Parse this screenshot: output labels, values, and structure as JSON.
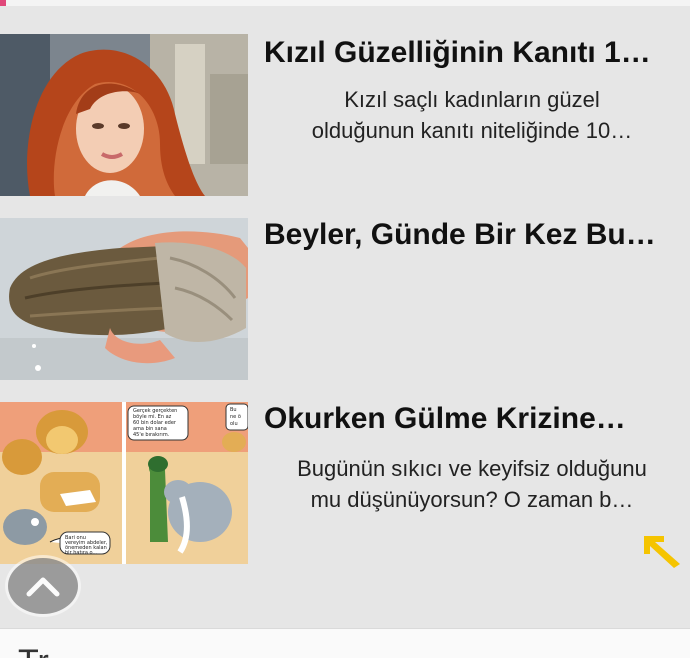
{
  "articles": [
    {
      "title": "Kızıl Güzelliğinin Kanıtı 1…",
      "excerpt_line1": "Kızıl saçlı kadınların güzel",
      "excerpt_line2": "olduğunun kanıtı niteliğinde 10…"
    },
    {
      "title": "Beyler, Günde Bir Kez Bu…",
      "excerpt_line1": "",
      "excerpt_line2": ""
    },
    {
      "title": "Okurken Gülme Krizine…",
      "excerpt_line1": "Bugünün sıkıcı ve keyifsiz olduğunu",
      "excerpt_line2": "mu düşünüyorsun? O zaman b…"
    }
  ],
  "comic": {
    "bubble_left": [
      "Gerçek gerçekten",
      "böyle mi. En az",
      "60 bin dolar eder",
      "ama bin sana",
      "45'e bırakırım."
    ],
    "bubble_bottom": [
      "Bari onu",
      "vereyim abdeler,",
      "önemeden kalan",
      "bir hatıra o..."
    ],
    "bubble_right": [
      "Bu",
      "ne ö",
      "olu"
    ]
  },
  "icons": {
    "scroll_top": "chevron-up-icon",
    "share": "arrow-up-left-icon"
  },
  "colors": {
    "accent": "#f5c400",
    "scroll_button": "#8e8e8e",
    "pink_marker": "#e0487a"
  },
  "bottom": {
    "heading": "Tr"
  }
}
